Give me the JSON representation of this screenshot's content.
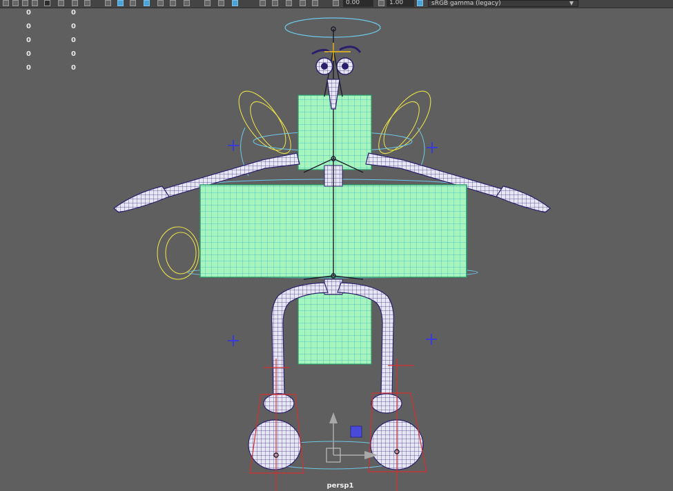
{
  "toolbar": {
    "exposure_value": "0.00",
    "gamma_value": "1.00",
    "color_space": "sRGB gamma (legacy)",
    "icons": [
      "grid-icon",
      "film-gate-icon",
      "camera-icon",
      "image-plane-icon",
      "resolution-gate-icon",
      "safe-area-icon",
      "field-chart-icon",
      "wireframe-icon",
      "smooth-shade-icon",
      "shade-all-icon",
      "lighting-icon",
      "shadows-icon",
      "textures-icon",
      "ambient-occlusion-icon",
      "motion-blur-icon",
      "anti-alias-icon",
      "isolate-icon",
      "xray-icon",
      "xray-joints-icon",
      "backface-icon",
      "exposure-icon",
      "gamma-icon",
      "color-management-icon"
    ]
  },
  "hud": {
    "rows": [
      {
        "a": "0",
        "b": "0"
      },
      {
        "a": "0",
        "b": "0"
      },
      {
        "a": "0",
        "b": "0"
      },
      {
        "a": "0",
        "b": "0"
      },
      {
        "a": "0",
        "b": "0"
      }
    ]
  },
  "viewport": {
    "camera": "persp1",
    "background": "#5f5f5f",
    "mesh_color": "#9ff3b6",
    "wire_color": "#3ab5c8",
    "skin_color": "#d8d8f0",
    "control_yellow": "#e8e04a",
    "control_cyan": "#6ec9ea",
    "locator_blue": "#3a3ad6",
    "ik_red": "#d43030"
  }
}
